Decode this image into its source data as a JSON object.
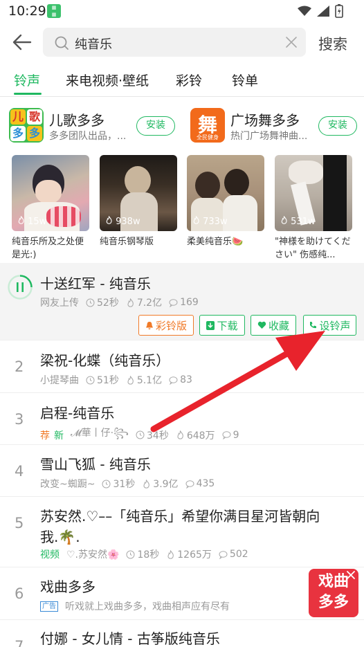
{
  "status": {
    "time": "10:29"
  },
  "search": {
    "query": "纯音乐",
    "button": "搜索"
  },
  "tabs": [
    "铃声",
    "来电视频·壁纸",
    "彩铃",
    "铃单"
  ],
  "apps": [
    {
      "name": "儿歌多多",
      "desc": "多多团队出品，...",
      "install": "安装",
      "logo_text": "儿歌多多"
    },
    {
      "name": "广场舞多多",
      "desc": "热门广场舞神曲...",
      "install": "安装",
      "logo_text": "舞",
      "logo_sub": "全民健身"
    }
  ],
  "videos": [
    {
      "count": "15w",
      "title": "纯音乐所及之处便是光:)"
    },
    {
      "count": "938w",
      "title": "纯音乐钢琴版"
    },
    {
      "count": "733w",
      "title": "柔美纯音乐🍉"
    },
    {
      "count": "531w",
      "title": "\"神様を助けてください\" 伤感纯..."
    }
  ],
  "songs": [
    {
      "num": "",
      "title": "十送红军 - 纯音乐",
      "source": "网友上传",
      "duration": "52秒",
      "plays": "7.2亿",
      "comments": "169"
    },
    {
      "num": "2",
      "title": "梁祝-化蝶（纯音乐）",
      "source": "小提琴曲",
      "duration": "51秒",
      "plays": "5.1亿",
      "comments": "83"
    },
    {
      "num": "3",
      "title": "启程-纯音乐",
      "tag1": "荐",
      "tag2": "新",
      "source": "𝓜華丨仔·꧂",
      "duration": "34秒",
      "plays": "648万",
      "comments": "9"
    },
    {
      "num": "4",
      "title": "雪山飞狐 - 纯音乐",
      "source": "改变~蜘蹰~",
      "duration": "31秒",
      "plays": "3.9亿",
      "comments": "435"
    },
    {
      "num": "5",
      "title": "苏安然.♡––「纯音乐」希望你满目星河皆朝向",
      "title2": "我.🌴.",
      "tag1": "视频",
      "source": "♡.苏安然🌸",
      "duration": "18秒",
      "plays": "1265万",
      "comments": "502"
    },
    {
      "num": "6",
      "title": "戏曲多多",
      "ad": "广告",
      "source": "听戏就上戏曲多多，戏曲相声应有尽有"
    },
    {
      "num": "7",
      "title": "付娜 - 女儿情 - 古筝版纯音乐"
    }
  ],
  "actions": {
    "crbt": "彩铃版",
    "download": "下载",
    "favorite": "收藏",
    "set_ringtone": "设铃声"
  },
  "float_ad": {
    "line1": "戏曲",
    "line2": "多多"
  },
  "colors": {
    "accent": "#1fb860",
    "orange": "#f07a28",
    "annotation_arrow": "#e8232c"
  }
}
